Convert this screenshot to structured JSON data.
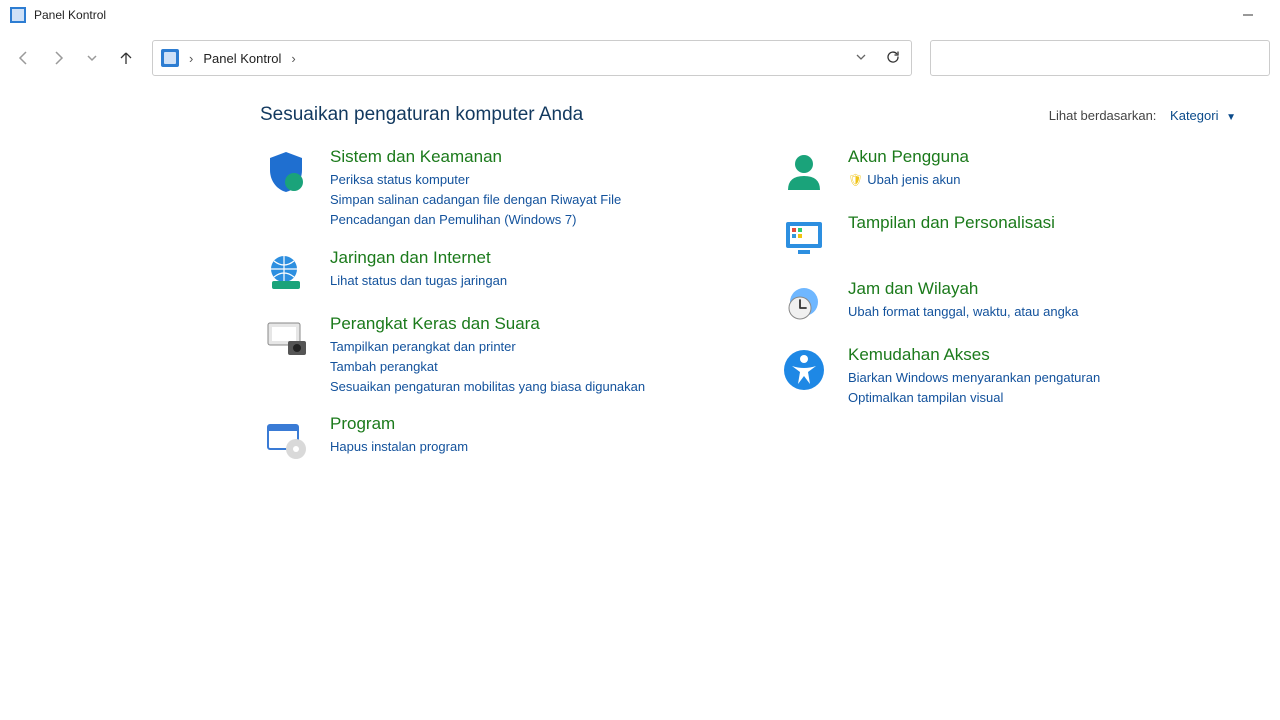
{
  "window": {
    "title": "Panel Kontrol"
  },
  "address_bar": {
    "crumb": "Panel Kontrol"
  },
  "heading": "Sesuaikan pengaturan komputer Anda",
  "viewby": {
    "label": "Lihat berdasarkan:",
    "value": "Kategori"
  },
  "left_column": [
    {
      "icon": "shield",
      "title": "Sistem dan Keamanan",
      "links": [
        "Periksa status komputer",
        "Simpan salinan cadangan file dengan Riwayat File",
        "Pencadangan dan Pemulihan (Windows 7)"
      ]
    },
    {
      "icon": "network",
      "title": "Jaringan dan Internet",
      "links": [
        "Lihat status dan tugas jaringan"
      ]
    },
    {
      "icon": "hardware",
      "title": "Perangkat Keras dan Suara",
      "links": [
        "Tampilkan perangkat dan printer",
        "Tambah perangkat",
        "Sesuaikan pengaturan mobilitas yang biasa digunakan"
      ]
    },
    {
      "icon": "programs",
      "title": "Program",
      "links": [
        "Hapus instalan program"
      ]
    }
  ],
  "right_column": [
    {
      "icon": "user",
      "title": "Akun Pengguna",
      "links": [
        {
          "text": "Ubah jenis akun",
          "shield": true
        }
      ]
    },
    {
      "icon": "personalize",
      "title": "Tampilan dan Personalisasi",
      "links": []
    },
    {
      "icon": "clock",
      "title": "Jam dan Wilayah",
      "links": [
        "Ubah format tanggal, waktu, atau angka"
      ]
    },
    {
      "icon": "ease",
      "title": "Kemudahan Akses",
      "links": [
        "Biarkan Windows menyarankan pengaturan",
        "Optimalkan tampilan visual"
      ]
    }
  ]
}
